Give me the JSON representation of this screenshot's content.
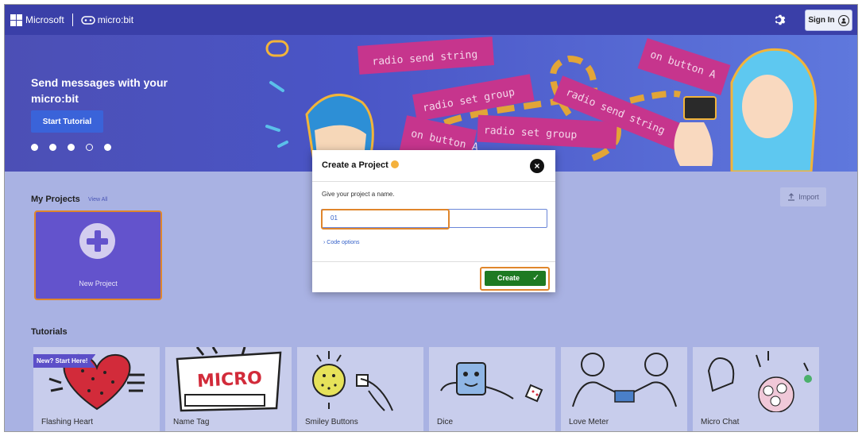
{
  "topbar": {
    "brand": "Microsoft",
    "product": "micro:bit",
    "sign_in": "Sign In"
  },
  "hero": {
    "title": "Send messages with your micro:bit",
    "button": "Start Tutorial",
    "slides_filled": [
      true,
      true,
      true,
      false,
      true
    ],
    "art_blocks": [
      "radio send string",
      "radio set group",
      "radio set group",
      "radio send string",
      "on button A",
      "on button A"
    ]
  },
  "projects": {
    "title": "My Projects",
    "view_all": "View All",
    "import": "Import",
    "new_project": "New Project"
  },
  "tutorials": {
    "title": "Tutorials",
    "badge": "New? Start Here!",
    "items": [
      {
        "label": "Flashing Heart"
      },
      {
        "label": "Name Tag"
      },
      {
        "label": "Smiley Buttons"
      },
      {
        "label": "Dice"
      },
      {
        "label": "Love Meter"
      },
      {
        "label": "Micro Chat"
      }
    ]
  },
  "dialog": {
    "title": "Create a Project",
    "prompt": "Give your project a name.",
    "name_value": "01",
    "code_options": "Code options",
    "create": "Create"
  },
  "colors": {
    "topbar": "#3a3fa8",
    "highlight": "#e0862c",
    "create": "#1e7a22"
  }
}
